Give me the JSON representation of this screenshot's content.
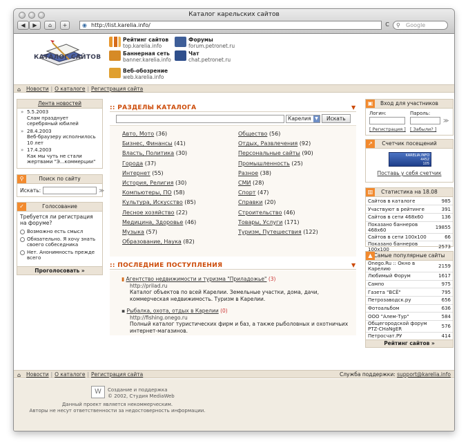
{
  "browser": {
    "title": "Каталог карельских сайтов",
    "url": "http://list.karelia.info/",
    "search_placeholder": "Google",
    "reload": "C"
  },
  "logo": {
    "text": "КАТАЛОГ САЙТОВ"
  },
  "header_links": [
    {
      "title": "Рейтинг сайтов",
      "url": "top.karelia.info"
    },
    {
      "title": "Форумы",
      "url": "forum.petronet.ru"
    },
    {
      "title": "Баннерная сеть",
      "url": "banner.karelia.info"
    },
    {
      "title": "Чат",
      "url": "chat.petronet.ru"
    },
    {
      "title": "Веб-обозрение",
      "url": "web.karelia.info"
    }
  ],
  "nav": {
    "news": "Новости",
    "about": "О каталоге",
    "register": "Регистрация сайта",
    "sep": "|"
  },
  "news": {
    "title": "Лента новостей",
    "items": [
      {
        "date": "5.5.2003",
        "text": "Слам празднует серебряный юбилей"
      },
      {
        "date": "28.4.2003",
        "text": "Веб-браузеру исполнилось 10 лет"
      },
      {
        "date": "17.4.2003",
        "text": "Как мы чуть не стали жертвами \"Э...коммерции\""
      }
    ]
  },
  "site_search": {
    "title": "Поиск по сайту",
    "label": "Искать:",
    "go": "≫"
  },
  "poll": {
    "title": "Голосование",
    "question": "Требуется ли регистрация на форуме?",
    "options": [
      "Возможно есть смысл",
      "Обязательно. Я хочу знать своего собеседника",
      "Нет. Анонимность прежде всего"
    ],
    "vote": "Проголосовать »"
  },
  "catalog": {
    "title": ":: РАЗДЕЛЫ КАТАЛОГА",
    "region": "Карелия",
    "search_button": "Искать",
    "left": [
      {
        "name": "Авто, Мото",
        "count": "(36)"
      },
      {
        "name": "Бизнес, Финансы",
        "count": "(41)"
      },
      {
        "name": "Власть, Политика",
        "count": "(30)"
      },
      {
        "name": "Города",
        "count": "(37)"
      },
      {
        "name": "Интернет",
        "count": "(55)"
      },
      {
        "name": "История, Религия",
        "count": "(30)"
      },
      {
        "name": "Компьютеры, ПО",
        "count": "(58)"
      },
      {
        "name": "Культура, Искусство",
        "count": "(85)"
      },
      {
        "name": "Лесное хозяйство",
        "count": "(22)"
      },
      {
        "name": "Медицина, Здоровье",
        "count": "(46)"
      },
      {
        "name": "Музыка",
        "count": "(57)"
      },
      {
        "name": "Образование, Наука",
        "count": "(82)"
      }
    ],
    "right": [
      {
        "name": "Общество",
        "count": "(56)"
      },
      {
        "name": "Отдых, Развлечения",
        "count": "(92)"
      },
      {
        "name": "Персональные сайты",
        "count": "(90)"
      },
      {
        "name": "Промышленность",
        "count": "(25)"
      },
      {
        "name": "Разное",
        "count": "(38)"
      },
      {
        "name": "СМИ",
        "count": "(28)"
      },
      {
        "name": "Спорт",
        "count": "(47)"
      },
      {
        "name": "Справки",
        "count": "(20)"
      },
      {
        "name": "Строительство",
        "count": "(46)"
      },
      {
        "name": "Товары, Услуги",
        "count": "(171)"
      },
      {
        "name": "Туризм, Путешествия",
        "count": "(122)"
      }
    ]
  },
  "recent": {
    "title": ":: ПОСЛЕДНИЕ ПОСТУПЛЕНИЯ",
    "items": [
      {
        "name": "Агентство недвижимости и туризма \"Приладожье\"",
        "count": "(3)",
        "url": "http://prilad.ru",
        "desc": "Каталог объектов по всей Карелии. Земельные участки, дома, дачи, коммерческая недвижимость. Туризм в Карелии."
      },
      {
        "name": "Рыбалка, охота, отдых в Карелии",
        "count": "(0)",
        "url": "http://fishing.onego.ru",
        "desc": "Полный каталог туристических фирм и баз, а также рыболовных и охотничьих интернет-магазинов."
      }
    ]
  },
  "login": {
    "title": "Вход для участников",
    "login_label": "Логин:",
    "password_label": "Пароль:",
    "register": "[ Регистрация ]",
    "forgot": "[ Забыли? ]",
    "go": "≫"
  },
  "counter": {
    "title": "Счетчик посещений",
    "banner_text": "KARELIA.INFO",
    "banner_n1": "4452",
    "banner_n2": "105",
    "link": "Поставь у себя счетчик"
  },
  "stats": {
    "title": "Статистика на 18.08",
    "rows": [
      {
        "k": "Сайтов в каталоге",
        "v": "985"
      },
      {
        "k": "Участвуют в рейтинге",
        "v": "391"
      },
      {
        "k": "Сайтов в сети 468x60",
        "v": "136"
      },
      {
        "k": "Показано баннеров 468x60",
        "v": "19855"
      },
      {
        "k": "Сайтов в сети 100x100",
        "v": "66"
      },
      {
        "k": "Показано баннеров 100x100",
        "v": "2573"
      }
    ]
  },
  "popular": {
    "title": "Самые популярные сайты",
    "rows": [
      {
        "k": "Onego.Ru :: Окно в Карелию",
        "v": "2159"
      },
      {
        "k": "Любимый Форум",
        "v": "1617"
      },
      {
        "k": "Сампо",
        "v": "975"
      },
      {
        "k": "Газета \"ВСЁ\"",
        "v": "795"
      },
      {
        "k": "Петрозаводск.ру",
        "v": "656"
      },
      {
        "k": "Фотоальбом",
        "v": "636"
      },
      {
        "k": "ООО \"Алем-Тур\"",
        "v": "584"
      },
      {
        "k": "Общегородской форум PTZ-CHaNgER",
        "v": "576"
      },
      {
        "k": "Петросчат.РУ",
        "v": "414"
      }
    ],
    "more": "Рейтинг сайтов »"
  },
  "footer": {
    "support_label": "Служба поддержки:",
    "support_email": "support@karelia.info",
    "credit1": "Создание и поддержка",
    "credit2": "© 2002, Студия MediaWeb",
    "note1": "Данный проект является некоммерческим.",
    "note2": "Авторы не несут ответственности за недостоверность информации."
  }
}
